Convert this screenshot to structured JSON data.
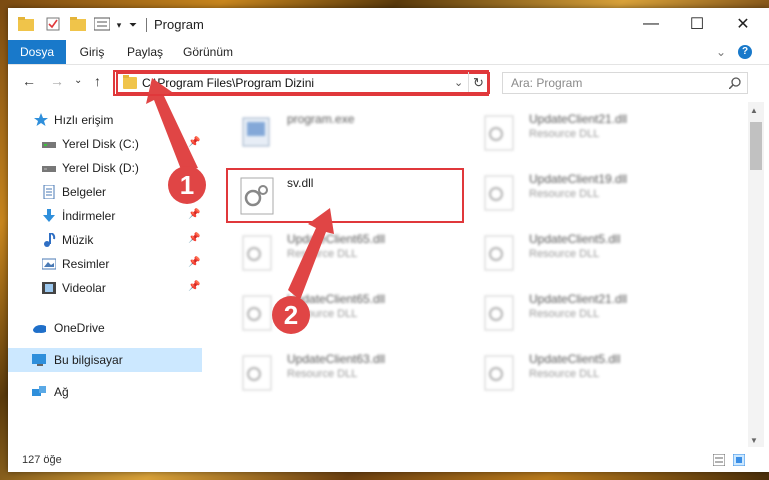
{
  "window": {
    "title": "Program",
    "minimize_label": "—",
    "maximize_label": "☐",
    "close_label": "✕"
  },
  "ribbon": {
    "tabs": [
      "Dosya",
      "Giriş",
      "Paylaş",
      "Görünüm"
    ],
    "help_label": "?",
    "collapse_label": "⌄"
  },
  "nav": {
    "back": "←",
    "forward": "→",
    "recent": "⌄",
    "up": "↑",
    "dropdown": "⌄",
    "refresh": "↻"
  },
  "address": {
    "path": "C:\\Program Files\\Program Dizini"
  },
  "search": {
    "placeholder": "Ara: Program",
    "icon": "search-icon"
  },
  "sidebar": {
    "items": [
      {
        "label": "Hızlı erişim",
        "icon": "star-icon",
        "color": "#2f8fdb"
      },
      {
        "label": "Yerel Disk (C:)",
        "icon": "drive-icon",
        "pin": "📌",
        "color": "#555555"
      },
      {
        "label": "Yerel Disk (D:)",
        "icon": "drive-icon",
        "pin": "📌",
        "color": "#555555"
      },
      {
        "label": "Belgeler",
        "icon": "document-icon",
        "pin": "📌",
        "color": "#4a7ab5"
      },
      {
        "label": "İndirmeler",
        "icon": "download-icon",
        "pin": "📌",
        "color": "#2f8fdb"
      },
      {
        "label": "Müzik",
        "icon": "music-icon",
        "pin": "📌",
        "color": "#2f6fc4"
      },
      {
        "label": "Resimler",
        "icon": "pictures-icon",
        "pin": "📌",
        "color": "#4a7ab5"
      },
      {
        "label": "Videolar",
        "icon": "video-icon",
        "pin": "📌",
        "color": "#444444"
      },
      {
        "label": "OneDrive",
        "icon": "cloud-icon",
        "color": "#1f6fc9"
      },
      {
        "label": "Bu bilgisayar",
        "icon": "computer-icon",
        "color": "#2f8fdb",
        "selected": true
      },
      {
        "label": "Ağ",
        "icon": "network-icon",
        "color": "#2f8fdb"
      }
    ]
  },
  "files": [
    {
      "name": "program.exe",
      "type": "",
      "icon": "exe-icon",
      "blurred": true
    },
    {
      "name": "UpdateClient21.dll",
      "type": "Resource DLL",
      "icon": "dll-icon",
      "blurred": true
    },
    {
      "name": "sv.dll",
      "type": "",
      "icon": "dll-icon",
      "blurred": false
    },
    {
      "name": "UpdateClient19.dll",
      "type": "Resource DLL",
      "icon": "dll-icon",
      "blurred": true
    },
    {
      "name": "UpdateClient65.dll",
      "type": "Resource DLL",
      "icon": "dll-icon",
      "blurred": true
    },
    {
      "name": "UpdateClient5.dll",
      "type": "Resource DLL",
      "icon": "dll-icon",
      "blurred": true
    },
    {
      "name": "UpdateClient65.dll",
      "type": "Resource DLL",
      "icon": "dll-icon",
      "blurred": true
    },
    {
      "name": "UpdateClient21.dll",
      "type": "Resource DLL",
      "icon": "dll-icon",
      "blurred": true
    },
    {
      "name": "UpdateClient63.dll",
      "type": "Resource DLL",
      "icon": "dll-icon",
      "blurred": true
    },
    {
      "name": "UpdateClient5.dll",
      "type": "Resource DLL",
      "icon": "dll-icon",
      "blurred": true
    }
  ],
  "status": {
    "item_count": "127 öğe"
  },
  "annotations": {
    "marker1": "1",
    "marker2": "2",
    "color": "#e04545"
  }
}
